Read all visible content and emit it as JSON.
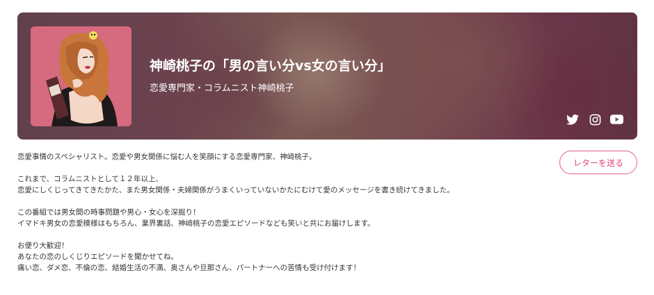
{
  "header": {
    "title": "神崎桃子の「男の言い分vs女の言い分」",
    "subtitle": "恋愛専門家・コラムニスト神崎桃子",
    "social_icons": [
      "twitter-icon",
      "instagram-icon",
      "youtube-icon"
    ]
  },
  "actions": {
    "letter_button_label": "レターを送る"
  },
  "description": {
    "lines": [
      "恋愛事情のスペシャリスト。恋愛や男女関係に悩む人を笑顔にする恋愛専門家、神崎桃子。",
      "",
      "これまで、コラムニストとして１２年以上、",
      "恋愛にしくじってきてきたかた、また男女関係・夫婦関係がうまくいっていないかたにむけて愛のメッセージを書き続けてきました。",
      "",
      "この番組では男女間の時事問題や男心・女心を深掘り！",
      "イマドキ男女の恋愛模様はもちろん、業界裏話、神崎桃子の恋愛エピソードなども笑いと共にお届けします。",
      "",
      "お便り大歓迎！",
      "あなたの恋のしくじりエピソードを聞かせてね。",
      "痛い恋、ダメ恋、不倫の恋、結婚生活の不満、奥さんや旦那さん、パートナーへの苦情も受け付けます！"
    ]
  },
  "colors": {
    "accent": "#e0447a",
    "cover_background": "#d66a7e",
    "hero_background": "#7b4d5b"
  }
}
